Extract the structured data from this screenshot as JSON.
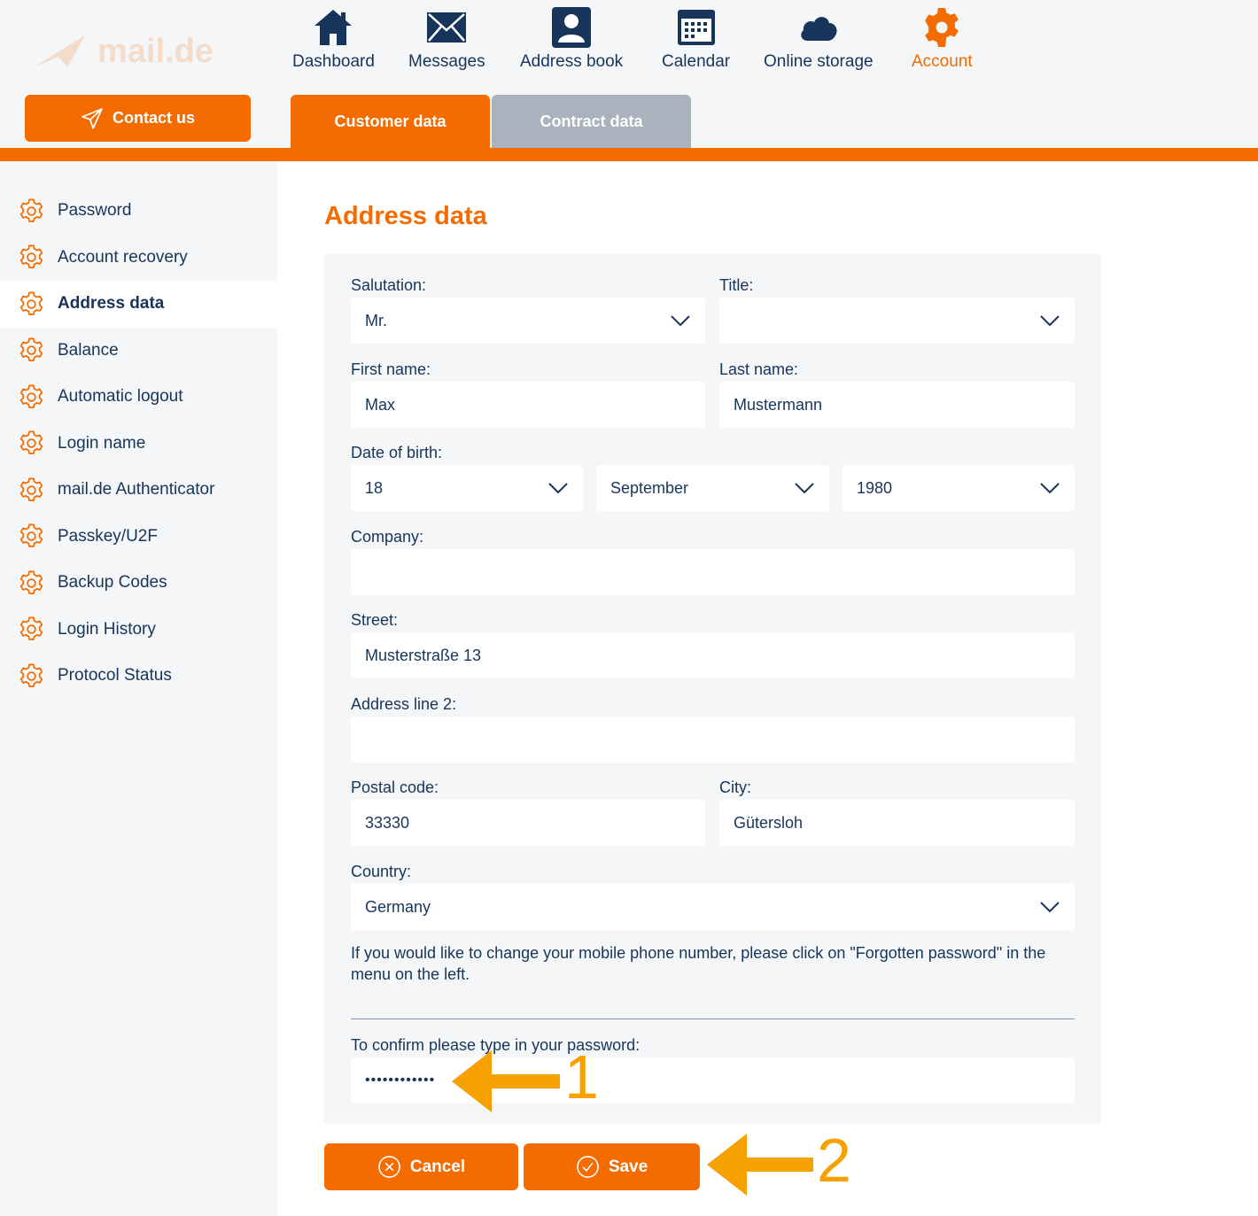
{
  "colors": {
    "accent": "#f46b00",
    "text": "#17355a",
    "tab_inactive": "#a9b2bd",
    "annotation": "#f7a100"
  },
  "logo": {
    "text": "mail.de"
  },
  "contact_button": {
    "label": "Contact us",
    "icon": "paper-plane-icon"
  },
  "top_nav": [
    {
      "label": "Dashboard",
      "icon": "house-icon"
    },
    {
      "label": "Messages",
      "icon": "envelope-icon"
    },
    {
      "label": "Address book",
      "icon": "contact-card-icon"
    },
    {
      "label": "Calendar",
      "icon": "calendar-icon"
    },
    {
      "label": "Online storage",
      "icon": "cloud-icon"
    },
    {
      "label": "Account",
      "icon": "gear-icon",
      "active": true
    }
  ],
  "tabs": [
    {
      "label": "Customer data",
      "active": true
    },
    {
      "label": "Contract data",
      "active": false
    }
  ],
  "sidebar": {
    "items": [
      {
        "label": "Password"
      },
      {
        "label": "Account recovery"
      },
      {
        "label": "Address data",
        "active": true
      },
      {
        "label": "Balance"
      },
      {
        "label": "Automatic logout"
      },
      {
        "label": "Login name"
      },
      {
        "label": "mail.de Authenticator"
      },
      {
        "label": "Passkey/U2F"
      },
      {
        "label": "Backup Codes"
      },
      {
        "label": "Login History"
      },
      {
        "label": "Protocol Status"
      }
    ]
  },
  "main": {
    "title": "Address data",
    "form": {
      "salutation": {
        "label": "Salutation:",
        "value": "Mr."
      },
      "title": {
        "label": "Title:",
        "value": ""
      },
      "first_name": {
        "label": "First name:",
        "value": "Max"
      },
      "last_name": {
        "label": "Last name:",
        "value": "Mustermann"
      },
      "dob": {
        "label": "Date of birth:",
        "day": "18",
        "month": "September",
        "year": "1980"
      },
      "company": {
        "label": "Company:",
        "value": ""
      },
      "street": {
        "label": "Street:",
        "value": "Musterstraße 13"
      },
      "address2": {
        "label": "Address line 2:",
        "value": ""
      },
      "postal": {
        "label": "Postal code:",
        "value": "33330"
      },
      "city": {
        "label": "City:",
        "value": "Gütersloh"
      },
      "country": {
        "label": "Country:",
        "value": "Germany"
      },
      "hint": "If you would like to change your mobile phone number, please click on \"Forgotten password\" in the menu on the left.",
      "confirm": {
        "label": "To confirm please type in your password:",
        "value": "••••••••••••"
      }
    },
    "buttons": {
      "cancel": "Cancel",
      "save": "Save"
    }
  },
  "annotations": {
    "arrow1": "1",
    "arrow2": "2"
  }
}
